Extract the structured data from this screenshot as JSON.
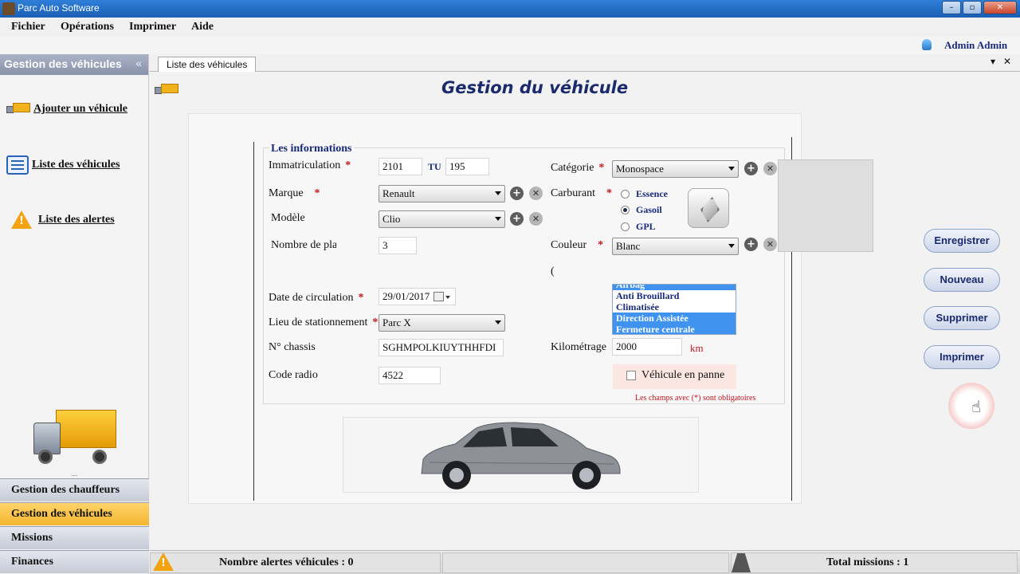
{
  "window": {
    "title": "Parc Auto Software",
    "controls": [
      "–",
      "▫",
      "✕"
    ]
  },
  "menu": [
    "Fichier",
    "Opérations",
    "Imprimer",
    "Aide"
  ],
  "user": {
    "name": "Admin Admin"
  },
  "sidebar": {
    "header": "Gestion des véhicules",
    "collapse": "«",
    "links": [
      "Ajouter un véhicule",
      "Liste des véhicules",
      "Liste des alertes"
    ],
    "dots": "....",
    "nav": [
      "Gestion des chauffeurs",
      "Gestion des véhicules",
      "Missions",
      "Finances"
    ],
    "active_nav": "Gestion des véhicules"
  },
  "tab": {
    "label": "Liste des véhicules",
    "pin": "▾",
    "close": "✕"
  },
  "page": {
    "title": "Gestion du véhicule"
  },
  "form": {
    "group_title": "Les informations",
    "required_mark": "*",
    "immatriculation": {
      "label": "Immatriculation",
      "part1": "2101",
      "sep": "TU",
      "part2": "195"
    },
    "marque": {
      "label": "Marque",
      "value": "Renault"
    },
    "modele": {
      "label": "Modèle",
      "value": "Clio"
    },
    "places": {
      "label": "Nombre de pla",
      "value": "3"
    },
    "categorie": {
      "label": "Catégorie",
      "value": "Monospace"
    },
    "carburant": {
      "label": "Carburant",
      "options": [
        "Essence",
        "Gasoil",
        "GPL"
      ],
      "selected": "Gasoil"
    },
    "couleur": {
      "label": "Couleur",
      "value": "Blanc"
    },
    "partial_label": "(",
    "date_circulation": {
      "label": "Date de circulation",
      "value": "29/01/2017"
    },
    "lieu": {
      "label": "Lieu de stationnement",
      "value": "Parc X"
    },
    "chassis": {
      "label": "N° chassis",
      "value": "SGHMPOLKIUYTHHFDI"
    },
    "radio": {
      "label": "Code radio",
      "value": "4522"
    },
    "options_list": [
      {
        "label": "Airbag",
        "selected": true
      },
      {
        "label": "Anti Brouillard",
        "selected": false
      },
      {
        "label": "Climatisée",
        "selected": false
      },
      {
        "label": "Direction Assistée",
        "selected": true
      },
      {
        "label": "Fermeture centrale",
        "selected": true
      }
    ],
    "kilometrage": {
      "label": "Kilométrage",
      "value": "2000",
      "unit": "km"
    },
    "panne": {
      "label": "Véhicule en panne",
      "checked": false
    },
    "note": "Les champs avec (*) sont obligatoires"
  },
  "actions": [
    "Enregistrer",
    "Nouveau",
    "Supprimer",
    "Imprimer"
  ],
  "status": {
    "alerts": "Nombre alertes véhicules  :  0",
    "missions": "Total missions  :  1"
  },
  "colors": {
    "title_blue": "#1a2a6c",
    "required_red": "#c0181e",
    "active_nav": "#f5b530",
    "list_selected": "#3f93ee"
  }
}
